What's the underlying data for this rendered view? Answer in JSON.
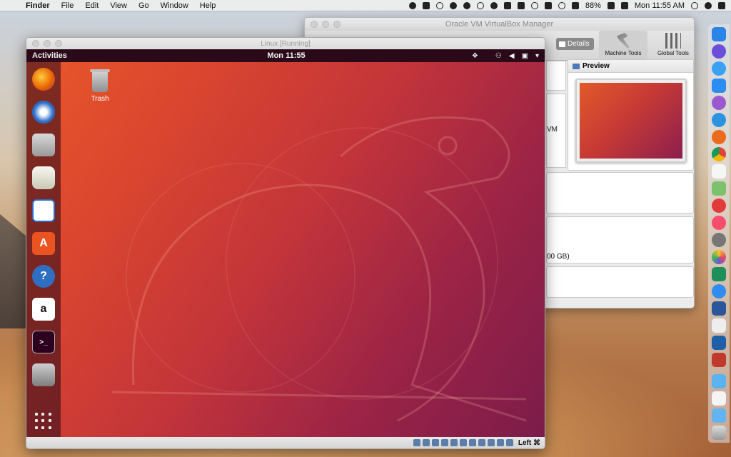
{
  "menubar": {
    "app": "Finder",
    "menus": [
      "File",
      "Edit",
      "View",
      "Go",
      "Window",
      "Help"
    ],
    "battery": "88%",
    "clock": "Mon 11:55 AM"
  },
  "vbox_manager": {
    "title": "Oracle VM VirtualBox Manager",
    "details_label": "Details",
    "machine_tools_label": "Machine Tools",
    "global_tools_label": "Global Tools",
    "preview_label": "Preview",
    "peek_texts": [
      "VM",
      "00 GB)"
    ]
  },
  "vm_window": {
    "title": "Linux [Running]",
    "ubuntu": {
      "activities": "Activities",
      "clock": "Mon 11:55",
      "trash_label": "Trash"
    },
    "host_key": "Left ⌘"
  },
  "colors": {
    "ubuntu_top": "#2a0a18",
    "ubuntu_bg_start": "#e8582a",
    "ubuntu_bg_end": "#7b1c4a"
  }
}
